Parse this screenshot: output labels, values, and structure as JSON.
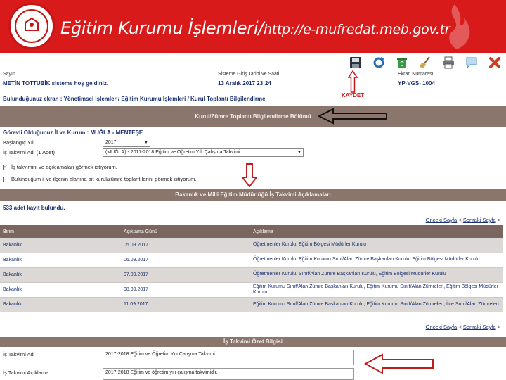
{
  "header": {
    "title": "Eğitim Kurumu İşlemleri/",
    "url": "http://e-mufredat.meb.gov.tr"
  },
  "toolbar": {
    "icons": [
      "save-icon",
      "refresh-icon",
      "recycle-icon",
      "broom-icon",
      "print-icon",
      "comment-icon",
      "close-icon"
    ],
    "save_caption": "KAYDET"
  },
  "info": {
    "greeting_label": "Sayın",
    "greeting_value": "METİN TOTTUBİK sisteme hoş geldiniz.",
    "login_label": "Sisteme Giriş Tarihi ve Saati",
    "login_value": "13 Aralık 2017 23:24",
    "screen_label": "Ekran Numarası",
    "screen_value": "YP-VGS- 1004"
  },
  "location": "Bulunduğunuz ekran : Yönetimsel İşlemler / Eğitim Kurumu İşlemleri / Kurul Toplantı Bilgilendirme",
  "section_title": "Kurul/Zümre Toplantı Bilgilendirme Bölümü",
  "form": {
    "duty_line": "Görevli Olduğunuz İl ve Kurum : MUĞLA - MENTEŞE",
    "start_year_label": "Başlangıç Yılı",
    "start_year_value": "2017",
    "calendar_label": "İş Takvimi Adı (1 Adet)",
    "calendar_value": "(MUĞLA) - 2017-2018 Eğitim ve Öğretim Yılı Çalışma Takvimi",
    "chk1_label": "İş takvimini ve açıklamaları görmek istiyorum.",
    "chk1_checked": true,
    "chk2_label": "Bulunduğum il ve ilçenin alanına ait kurul/zümre toplantılarını görmek istiyorum.",
    "chk2_checked": false
  },
  "list_section_title": "Bakanlık ve Milli Eğitim Müdürlüğü İş Takvimi Açıklamaları",
  "records_text": "533 adet kayıt bulundu.",
  "pager": {
    "prev": "Önceki Sayfa",
    "sep": "<",
    "next": "Sonraki Sayfa",
    "tail": ">"
  },
  "table": {
    "headers": [
      "Birim",
      "Açıklama Günü",
      "Açıklama"
    ],
    "rows": [
      [
        "Bakanlık",
        "05.09.2017",
        "Öğretmenler Kurulu, Eğitim Bölgesi Müdürler Kurulu"
      ],
      [
        "Bakanlık",
        "06.09.2017",
        "Öğretmenler Kurulu, Eğitim Kurumu Sınıf/Alan Zümre Başkanları Kurulu, Eğitim Bölgesi Müdürler Kurulu"
      ],
      [
        "Bakanlık",
        "07.09.2017",
        "Öğretmenler Kurulu, Sınıf/Alan Zümre Başkanları Kurulu, Eğitim Bölgesi Müdürler Kurulu"
      ],
      [
        "Bakanlık",
        "08.09.2017",
        "Eğitim Kurumu Sınıf/Alan Zümre Başkanları Kurulu, Eğitim Kurumu Sınıf/Alan Zümreleri, Eğitim Bölgesi Müdürler Kurulu"
      ],
      [
        "Bakanlık",
        "11.09.2017",
        "Eğitim Kurumu Sınıf/Alan Zümre Başkanları Kurulu, Eğitim Kurumu Sınıf/Alan Zümreleri, İlçe Sınıf/Alan Zümreleri"
      ]
    ]
  },
  "summary": {
    "title": "İş Takvimi Özet Bilgisi",
    "name_label": "İş Takvimi Adı",
    "name_value": "2017-2018 Eğitim ve Öğretim Yılı Çalışma Takvimi",
    "desc_label": "İş Takvimi Açıklama",
    "desc_value": "2017-2018 Eğitim ve öğretim yılı çalışma takvimidir."
  },
  "colors": {
    "header_red": "#d91a1a",
    "bar_brown": "#8a766d",
    "link_navy": "#1b2f6e",
    "arrow_red": "#c21b1b"
  }
}
